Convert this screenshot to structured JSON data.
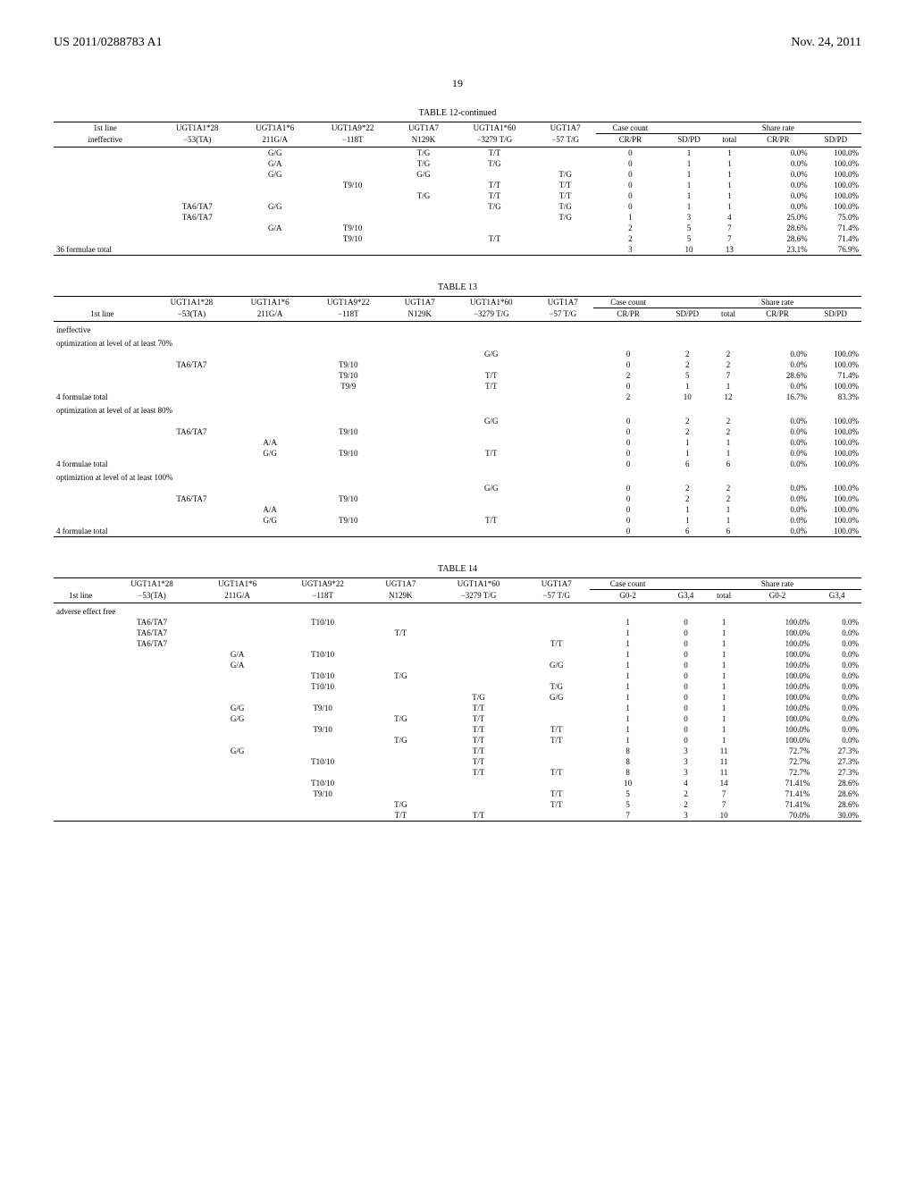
{
  "header": {
    "left": "US 2011/0288783 A1",
    "right": "Nov. 24, 2011"
  },
  "page": "19",
  "table12": {
    "title": "TABLE 12-continued",
    "h1": [
      "1st line",
      "UGT1A1*28",
      "UGT1A1*6",
      "UGT1A9*22",
      "UGT1A7",
      "UGT1A1*60",
      "UGT1A7",
      "Case count",
      "",
      "",
      "Share rate",
      ""
    ],
    "h2": [
      "ineffective",
      "−53(TA)",
      "211G/A",
      "−118T",
      "N129K",
      "−3279 T/G",
      "−57 T/G",
      "CR/PR",
      "SD/PD",
      "total",
      "CR/PR",
      "SD/PD"
    ],
    "rows": [
      [
        "",
        "",
        "G/G",
        "",
        "T/G",
        "T/T",
        "",
        "0",
        "1",
        "1",
        "0.0%",
        "100.0%"
      ],
      [
        "",
        "",
        "G/A",
        "",
        "T/G",
        "T/G",
        "",
        "0",
        "1",
        "1",
        "0.0%",
        "100.0%"
      ],
      [
        "",
        "",
        "G/G",
        "",
        "G/G",
        "",
        "T/G",
        "0",
        "1",
        "1",
        "0.0%",
        "100.0%"
      ],
      [
        "",
        "",
        "",
        "T9/10",
        "",
        "T/T",
        "T/T",
        "0",
        "1",
        "1",
        "0.0%",
        "100.0%"
      ],
      [
        "",
        "",
        "",
        "",
        "T/G",
        "T/T",
        "T/T",
        "0",
        "1",
        "1",
        "0.0%",
        "100.0%"
      ],
      [
        "",
        "TA6/TA7",
        "G/G",
        "",
        "",
        "T/G",
        "T/G",
        "0",
        "1",
        "1",
        "0.0%",
        "100.0%"
      ],
      [
        "",
        "TA6/TA7",
        "",
        "",
        "",
        "",
        "T/G",
        "1",
        "3",
        "4",
        "25.0%",
        "75.0%"
      ],
      [
        "",
        "",
        "G/A",
        "T9/10",
        "",
        "",
        "",
        "2",
        "5",
        "7",
        "28.6%",
        "71.4%"
      ],
      [
        "",
        "",
        "",
        "T9/10",
        "",
        "T/T",
        "",
        "2",
        "5",
        "7",
        "28.6%",
        "71.4%"
      ],
      [
        "36 formulae total",
        "",
        "",
        "",
        "",
        "",
        "",
        "3",
        "10",
        "13",
        "23.1%",
        "76.9%"
      ]
    ]
  },
  "table13": {
    "title": "TABLE 13",
    "h1": [
      "",
      "UGT1A1*28",
      "UGT1A1*6",
      "UGT1A9*22",
      "UGT1A7",
      "UGT1A1*60",
      "UGT1A7",
      "Case count",
      "",
      "",
      "Share rate",
      ""
    ],
    "h2": [
      "1st line",
      "−53(TA)",
      "211G/A",
      "−118T",
      "N129K",
      "−3279 T/G",
      "−57 T/G",
      "CR/PR",
      "SD/PD",
      "total",
      "CR/PR",
      "SD/PD"
    ],
    "sec1": "ineffective",
    "sec1b": "optimization at level of at least 70%",
    "rows1": [
      [
        "",
        "",
        "",
        "",
        "",
        "G/G",
        "",
        "0",
        "2",
        "2",
        "0.0%",
        "100.0%"
      ],
      [
        "",
        "TA6/TA7",
        "",
        "T9/10",
        "",
        "",
        "",
        "0",
        "2",
        "2",
        "0.0%",
        "100.0%"
      ],
      [
        "",
        "",
        "",
        "T9/10",
        "",
        "T/T",
        "",
        "2",
        "5",
        "7",
        "28.6%",
        "71.4%"
      ],
      [
        "",
        "",
        "",
        "T9/9",
        "",
        "T/T",
        "",
        "0",
        "1",
        "1",
        "0.0%",
        "100.0%"
      ],
      [
        "4 formulae total",
        "",
        "",
        "",
        "",
        "",
        "",
        "2",
        "10",
        "12",
        "16.7%",
        "83.3%"
      ]
    ],
    "sec2": "optimization at level of at least 80%",
    "rows2": [
      [
        "",
        "",
        "",
        "",
        "",
        "G/G",
        "",
        "0",
        "2",
        "2",
        "0.0%",
        "100.0%"
      ],
      [
        "",
        "TA6/TA7",
        "",
        "T9/10",
        "",
        "",
        "",
        "0",
        "2",
        "2",
        "0.0%",
        "100.0%"
      ],
      [
        "",
        "",
        "A/A",
        "",
        "",
        "",
        "",
        "0",
        "1",
        "1",
        "0.0%",
        "100.0%"
      ],
      [
        "",
        "",
        "G/G",
        "T9/10",
        "",
        "T/T",
        "",
        "0",
        "1",
        "1",
        "0.0%",
        "100.0%"
      ],
      [
        "4 formulae total",
        "",
        "",
        "",
        "",
        "",
        "",
        "0",
        "6",
        "6",
        "0.0%",
        "100.0%"
      ]
    ],
    "sec3": "optimiztion at level of at least 100%",
    "rows3": [
      [
        "",
        "",
        "",
        "",
        "",
        "G/G",
        "",
        "0",
        "2",
        "2",
        "0.0%",
        "100.0%"
      ],
      [
        "",
        "TA6/TA7",
        "",
        "T9/10",
        "",
        "",
        "",
        "0",
        "2",
        "2",
        "0.0%",
        "100.0%"
      ],
      [
        "",
        "",
        "A/A",
        "",
        "",
        "",
        "",
        "0",
        "1",
        "1",
        "0.0%",
        "100.0%"
      ],
      [
        "",
        "",
        "G/G",
        "T9/10",
        "",
        "T/T",
        "",
        "0",
        "1",
        "1",
        "0.0%",
        "100.0%"
      ],
      [
        "4 formulae total",
        "",
        "",
        "",
        "",
        "",
        "",
        "0",
        "6",
        "6",
        "0.0%",
        "100.0%"
      ]
    ]
  },
  "table14": {
    "title": "TABLE 14",
    "h1": [
      "",
      "UGT1A1*28",
      "UGT1A1*6",
      "UGT1A9*22",
      "UGT1A7",
      "UGT1A1*60",
      "UGT1A7",
      "Case count",
      "",
      "",
      "Share rate",
      ""
    ],
    "h2": [
      "1st line",
      "−53(TA)",
      "211G/A",
      "−118T",
      "N129K",
      "−3279 T/G",
      "−57 T/G",
      "G0-2",
      "G3,4",
      "total",
      "G0-2",
      "G3,4"
    ],
    "sec1": "adverse effect free",
    "rows": [
      [
        "",
        "TA6/TA7",
        "",
        "T10/10",
        "",
        "",
        "",
        "1",
        "0",
        "1",
        "100.0%",
        "0.0%"
      ],
      [
        "",
        "TA6/TA7",
        "",
        "",
        "T/T",
        "",
        "",
        "1",
        "0",
        "1",
        "100.0%",
        "0.0%"
      ],
      [
        "",
        "TA6/TA7",
        "",
        "",
        "",
        "",
        "T/T",
        "1",
        "0",
        "1",
        "100.0%",
        "0.0%"
      ],
      [
        "",
        "",
        "G/A",
        "T10/10",
        "",
        "",
        "",
        "1",
        "0",
        "1",
        "100.0%",
        "0.0%"
      ],
      [
        "",
        "",
        "G/A",
        "",
        "",
        "",
        "G/G",
        "1",
        "0",
        "1",
        "100.0%",
        "0.0%"
      ],
      [
        "",
        "",
        "",
        "T10/10",
        "T/G",
        "",
        "",
        "1",
        "0",
        "1",
        "100.0%",
        "0.0%"
      ],
      [
        "",
        "",
        "",
        "T10/10",
        "",
        "",
        "T/G",
        "1",
        "0",
        "1",
        "100.0%",
        "0.0%"
      ],
      [
        "",
        "",
        "",
        "",
        "",
        "T/G",
        "G/G",
        "1",
        "0",
        "1",
        "100.0%",
        "0.0%"
      ],
      [
        "",
        "",
        "G/G",
        "T9/10",
        "",
        "T/T",
        "",
        "1",
        "0",
        "1",
        "100.0%",
        "0.0%"
      ],
      [
        "",
        "",
        "G/G",
        "",
        "T/G",
        "T/T",
        "",
        "1",
        "0",
        "1",
        "100.0%",
        "0.0%"
      ],
      [
        "",
        "",
        "",
        "T9/10",
        "",
        "T/T",
        "T/T",
        "1",
        "0",
        "1",
        "100.0%",
        "0.0%"
      ],
      [
        "",
        "",
        "",
        "",
        "T/G",
        "T/T",
        "T/T",
        "1",
        "0",
        "1",
        "100.0%",
        "0.0%"
      ],
      [
        "",
        "",
        "G/G",
        "",
        "",
        "T/T",
        "",
        "8",
        "3",
        "11",
        "72.7%",
        "27.3%"
      ],
      [
        "",
        "",
        "",
        "T10/10",
        "",
        "T/T",
        "",
        "8",
        "3",
        "11",
        "72.7%",
        "27.3%"
      ],
      [
        "",
        "",
        "",
        "",
        "",
        "T/T",
        "T/T",
        "8",
        "3",
        "11",
        "72.7%",
        "27.3%"
      ],
      [
        "",
        "",
        "",
        "T10/10",
        "",
        "",
        "",
        "10",
        "4",
        "14",
        "71.41%",
        "28.6%"
      ],
      [
        "",
        "",
        "",
        "T9/10",
        "",
        "",
        "T/T",
        "5",
        "2",
        "7",
        "71.41%",
        "28.6%"
      ],
      [
        "",
        "",
        "",
        "",
        "T/G",
        "",
        "T/T",
        "5",
        "2",
        "7",
        "71.41%",
        "28.6%"
      ],
      [
        "",
        "",
        "",
        "",
        "T/T",
        "T/T",
        "",
        "7",
        "3",
        "10",
        "70.0%",
        "30.0%"
      ]
    ]
  }
}
